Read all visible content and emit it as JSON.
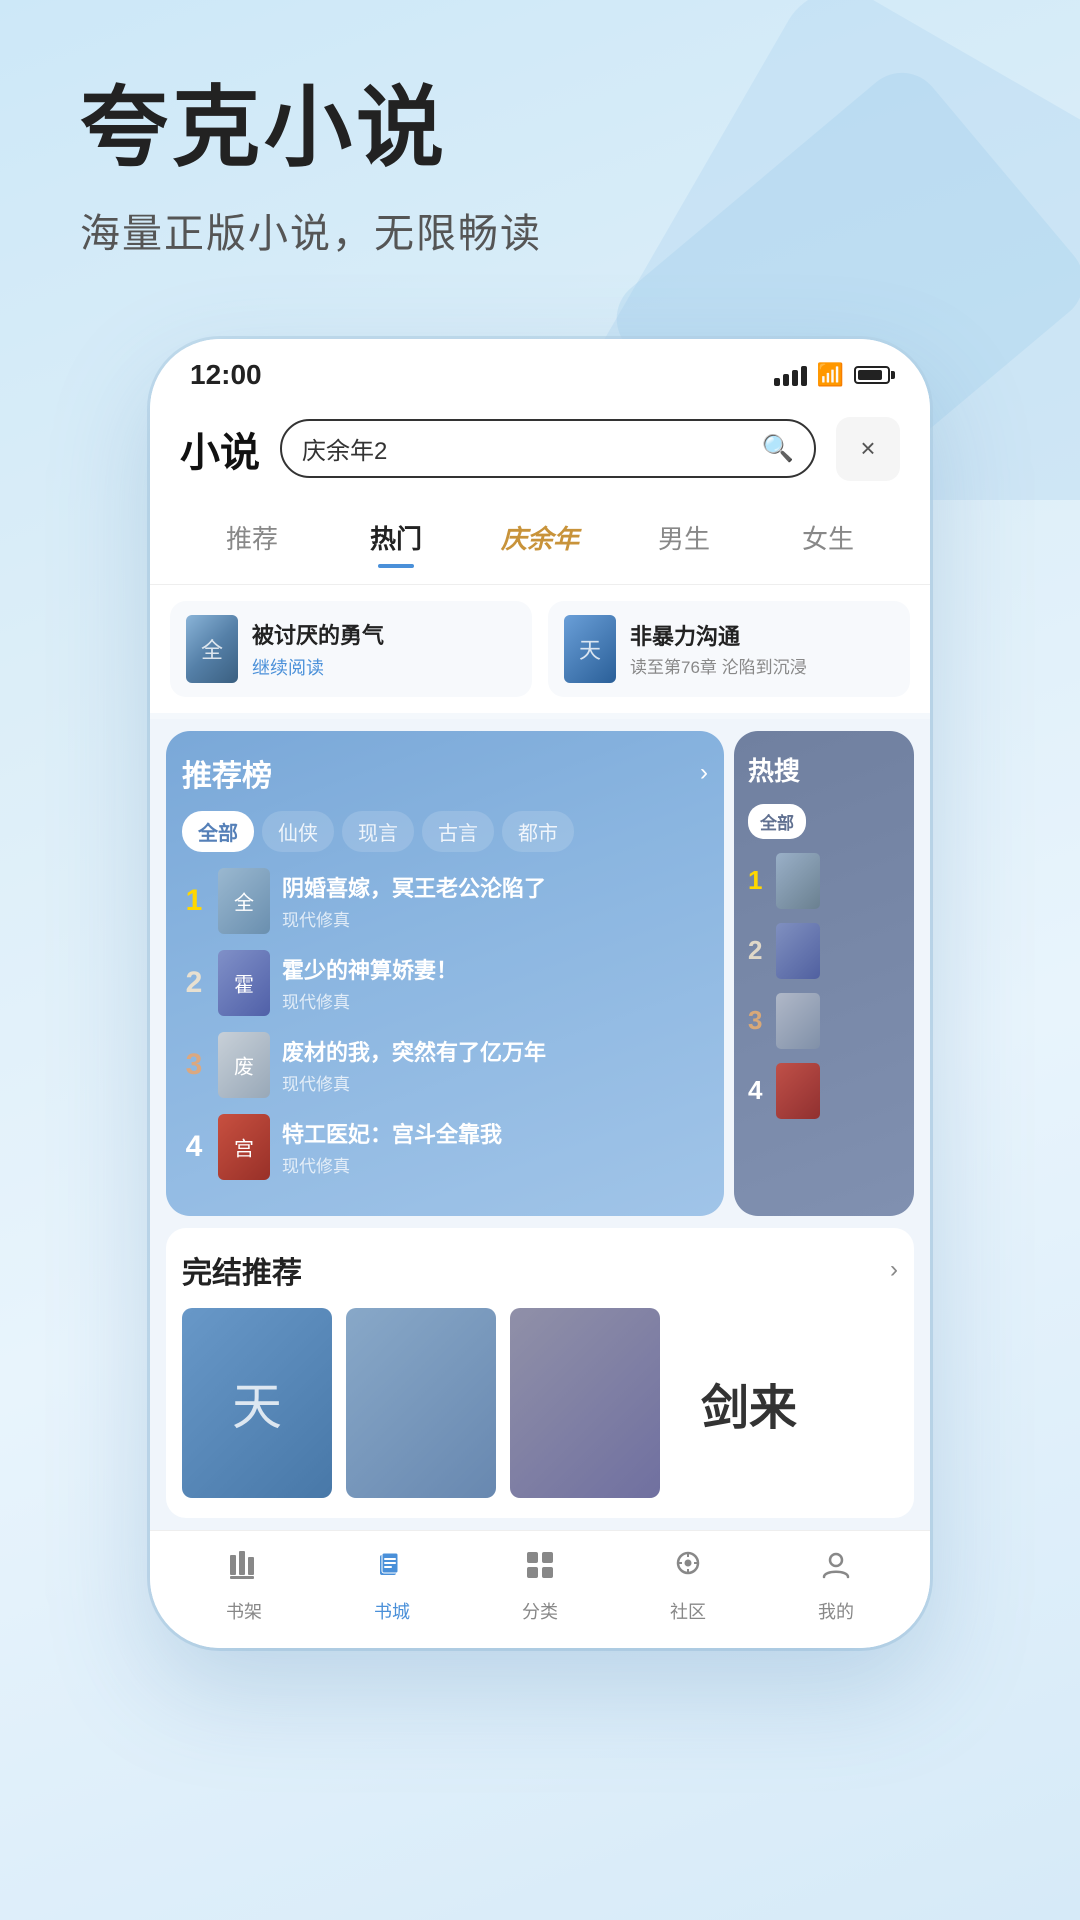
{
  "app": {
    "title": "夸克小说",
    "subtitle": "海量正版小说，无限畅读"
  },
  "status_bar": {
    "time": "12:00"
  },
  "header": {
    "logo": "小说",
    "search_placeholder": "庆余年2",
    "close_label": "×"
  },
  "nav_tabs": [
    {
      "label": "推荐",
      "active": false,
      "special": false
    },
    {
      "label": "热门",
      "active": true,
      "special": false
    },
    {
      "label": "庆余年",
      "active": false,
      "special": true
    },
    {
      "label": "男生",
      "active": false,
      "special": false
    },
    {
      "label": "女生",
      "active": false,
      "special": false
    }
  ],
  "recent_reads": [
    {
      "title": "被讨厌的勇气",
      "action": "继续阅读",
      "cover_char": "全"
    },
    {
      "title": "非暴力沟通",
      "progress": "读至第76章 沦陷到沉浸",
      "cover_char": "天"
    }
  ],
  "ranking": {
    "title": "推荐榜",
    "arrow": "›",
    "filters": [
      "全部",
      "仙侠",
      "现言",
      "古言",
      "都市"
    ],
    "active_filter": "全部",
    "items": [
      {
        "rank": 1,
        "title": "阴婚喜嫁，冥王老公沦陷了",
        "tag": "现代修真"
      },
      {
        "rank": 2,
        "title": "霍少的神算娇妻！",
        "tag": "现代修真"
      },
      {
        "rank": 3,
        "title": "废材的我，突然有了亿万年",
        "tag": "现代修真"
      },
      {
        "rank": 4,
        "title": "特工医妃：宫斗全靠我",
        "tag": "现代修真"
      }
    ]
  },
  "hot_search": {
    "title": "热搜",
    "filters": [
      "全部"
    ],
    "active_filter": "全部",
    "items": [
      {
        "rank": 1
      },
      {
        "rank": 2
      },
      {
        "rank": 3
      },
      {
        "rank": 4
      }
    ]
  },
  "completed": {
    "title": "完结推荐",
    "arrow": "›",
    "books": [
      {
        "cover_char": "天"
      },
      {
        "cover_char": ""
      },
      {
        "cover_char": ""
      },
      {
        "cover_char": "剑来"
      }
    ]
  },
  "bottom_nav": [
    {
      "label": "书架",
      "icon": "bookshelf",
      "active": false
    },
    {
      "label": "书城",
      "icon": "book",
      "active": true
    },
    {
      "label": "分类",
      "icon": "grid",
      "active": false
    },
    {
      "label": "社区",
      "icon": "community",
      "active": false
    },
    {
      "label": "我的",
      "icon": "user",
      "active": false
    }
  ]
}
